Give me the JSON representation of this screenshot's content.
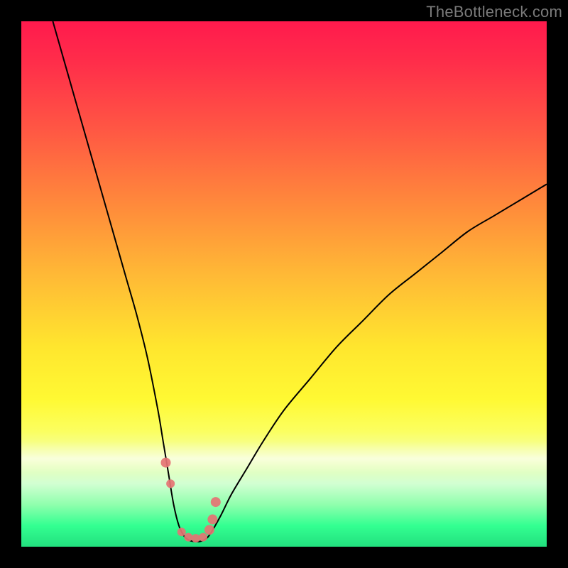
{
  "watermark": "TheBottleneck.com",
  "colors": {
    "frame": "#000000",
    "curve": "#000000",
    "marker": "#e57373"
  },
  "chart_data": {
    "type": "line",
    "title": "",
    "xlabel": "",
    "ylabel": "",
    "xlim": [
      0,
      100
    ],
    "ylim": [
      0,
      100
    ],
    "grid": false,
    "series": [
      {
        "name": "bottleneck-curve",
        "x": [
          6,
          8,
          10,
          12,
          14,
          16,
          18,
          20,
          22,
          24,
          26,
          27,
          28,
          29,
          30,
          31,
          32,
          33,
          34,
          35,
          36,
          38,
          40,
          43,
          46,
          50,
          55,
          60,
          65,
          70,
          75,
          80,
          85,
          90,
          95,
          100
        ],
        "y": [
          100,
          93,
          86,
          79,
          72,
          65,
          58,
          51,
          44,
          36,
          26,
          20,
          14,
          8,
          4,
          2,
          1.2,
          1,
          1,
          1.4,
          2.5,
          6,
          10,
          15,
          20,
          26,
          32,
          38,
          43,
          48,
          52,
          56,
          60,
          63,
          66,
          69
        ]
      }
    ],
    "markers": {
      "name": "highlight-points",
      "x": [
        27.5,
        28.4,
        30.5,
        31.8,
        33.2,
        34.6,
        35.8,
        36.4,
        37.0
      ],
      "y": [
        16,
        12,
        2.8,
        1.8,
        1.6,
        1.8,
        3.2,
        5.2,
        8.5
      ],
      "r": [
        7,
        6,
        6,
        6,
        6,
        6,
        7,
        7,
        7
      ]
    },
    "background_gradient": {
      "top": "#ff1a4d",
      "mid": "#ffe62e",
      "bottom": "#22e07e"
    }
  }
}
